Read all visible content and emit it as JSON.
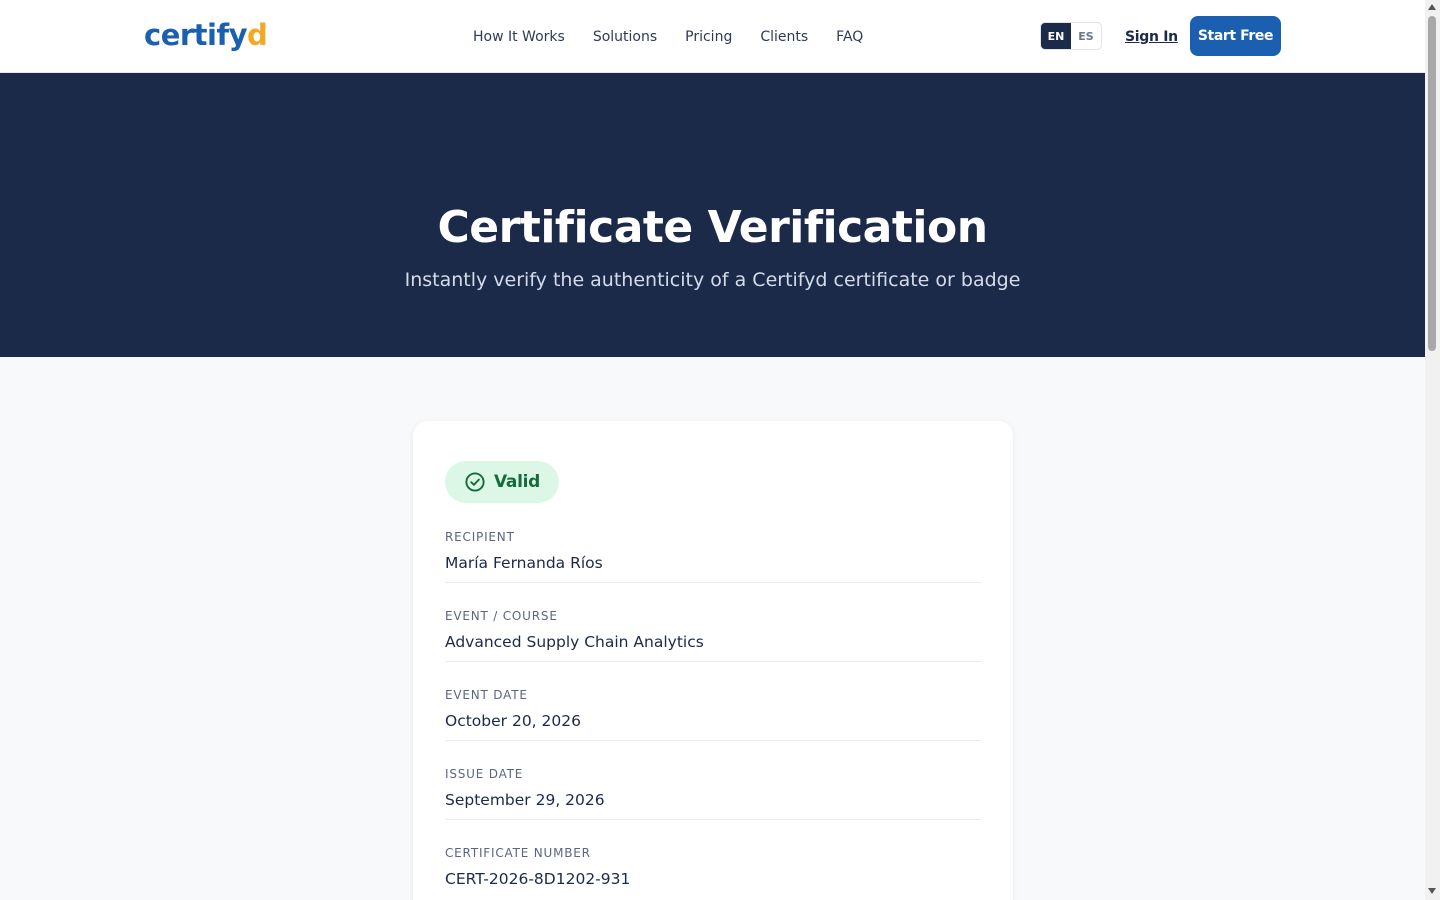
{
  "header": {
    "logo_main": "certify",
    "logo_accent": "d",
    "nav": [
      "How It Works",
      "Solutions",
      "Pricing",
      "Clients",
      "FAQ"
    ],
    "lang_options": [
      "EN",
      "ES"
    ],
    "lang_selected": "EN",
    "signin_label": "Sign In",
    "cta_label": "Start Free"
  },
  "hero": {
    "title": "Certificate Verification",
    "subtitle": "Instantly verify the authenticity of a Certifyd certificate or badge"
  },
  "certificate": {
    "status": "Valid",
    "status_icon": "check-circle-icon",
    "fields": [
      {
        "label": "RECIPIENT",
        "value": "María Fernanda Ríos"
      },
      {
        "label": "EVENT / COURSE",
        "value": "Advanced Supply Chain Analytics"
      },
      {
        "label": "EVENT DATE",
        "value": "October 20, 2026"
      },
      {
        "label": "ISSUE DATE",
        "value": "September 29, 2026"
      },
      {
        "label": "CERTIFICATE NUMBER",
        "value": "CERT-2026-8D1202-931"
      }
    ]
  },
  "colors": {
    "brand_blue": "#1a5fb0",
    "brand_accent": "#f5a623",
    "hero_bg": "#1c2a4a",
    "valid_bg": "#dcf7e6",
    "valid_text": "#146c3a"
  }
}
